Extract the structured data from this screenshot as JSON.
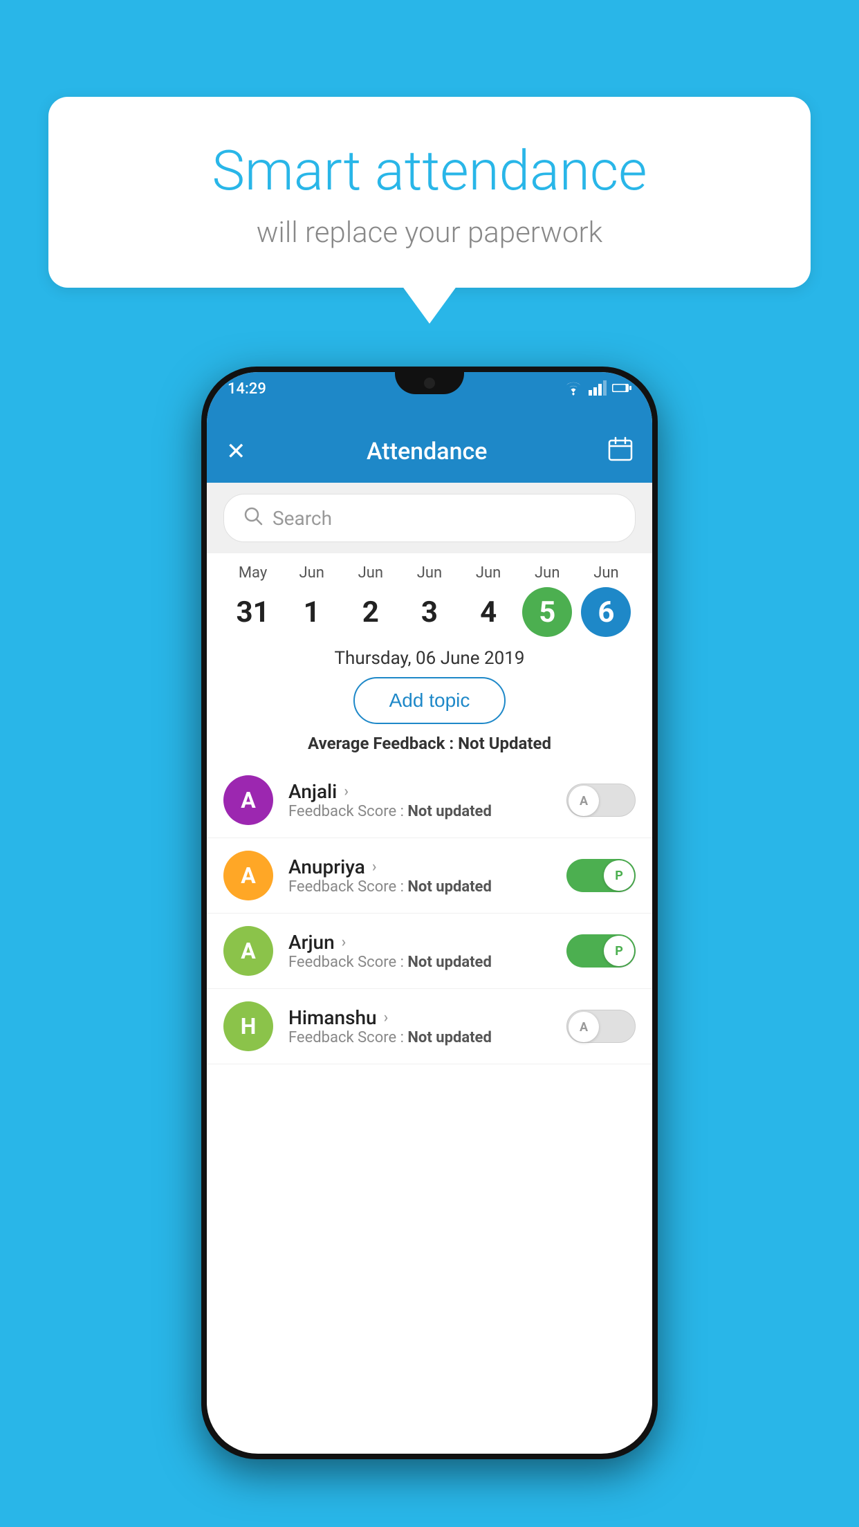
{
  "background": {
    "color": "#29b6e8"
  },
  "speech_bubble": {
    "title": "Smart attendance",
    "subtitle": "will replace your paperwork"
  },
  "phone": {
    "status_bar": {
      "time": "14:29",
      "wifi_icon": "wifi-icon",
      "signal_icon": "signal-icon",
      "battery_icon": "battery-icon"
    },
    "app_bar": {
      "close_label": "✕",
      "title": "Attendance",
      "calendar_icon": "calendar-icon"
    },
    "search": {
      "placeholder": "Search"
    },
    "calendar": {
      "days": [
        {
          "month": "May",
          "date": "31",
          "style": "normal"
        },
        {
          "month": "Jun",
          "date": "1",
          "style": "normal"
        },
        {
          "month": "Jun",
          "date": "2",
          "style": "normal"
        },
        {
          "month": "Jun",
          "date": "3",
          "style": "normal"
        },
        {
          "month": "Jun",
          "date": "4",
          "style": "normal"
        },
        {
          "month": "Jun",
          "date": "5",
          "style": "today"
        },
        {
          "month": "Jun",
          "date": "6",
          "style": "selected"
        }
      ],
      "selected_date_label": "Thursday, 06 June 2019"
    },
    "add_topic_label": "Add topic",
    "avg_feedback_label": "Average Feedback :",
    "avg_feedback_value": "Not Updated",
    "students": [
      {
        "name": "Anjali",
        "avatar_letter": "A",
        "avatar_color": "#9c27b0",
        "feedback_label": "Feedback Score :",
        "feedback_value": "Not updated",
        "toggle": "off",
        "toggle_letter": "A"
      },
      {
        "name": "Anupriya",
        "avatar_letter": "A",
        "avatar_color": "#ffa726",
        "feedback_label": "Feedback Score :",
        "feedback_value": "Not updated",
        "toggle": "on",
        "toggle_letter": "P"
      },
      {
        "name": "Arjun",
        "avatar_letter": "A",
        "avatar_color": "#8bc34a",
        "feedback_label": "Feedback Score :",
        "feedback_value": "Not updated",
        "toggle": "on",
        "toggle_letter": "P"
      },
      {
        "name": "Himanshu",
        "avatar_letter": "H",
        "avatar_color": "#8bc34a",
        "feedback_label": "Feedback Score :",
        "feedback_value": "Not updated",
        "toggle": "off",
        "toggle_letter": "A"
      }
    ]
  }
}
